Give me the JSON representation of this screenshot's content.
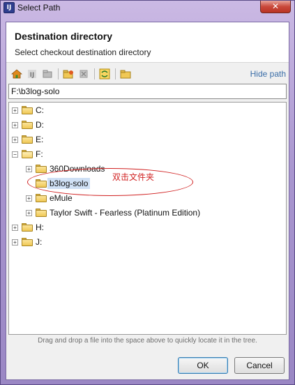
{
  "window": {
    "title": "Select Path",
    "app_icon_text": "IJ",
    "close_glyph": "✕"
  },
  "header": {
    "title": "Destination directory",
    "subtitle": "Select checkout destination directory"
  },
  "toolbar": {
    "icons": [
      "home-icon",
      "project-icon",
      "module-icon",
      "new-folder-icon",
      "delete-icon",
      "refresh-icon",
      "show-hidden-icon"
    ],
    "hide_path_label": "Hide path"
  },
  "path": {
    "value": "F:\\b3log-solo"
  },
  "tree": {
    "nodes": [
      {
        "label": "C:",
        "expanded": false,
        "level": 0
      },
      {
        "label": "D:",
        "expanded": false,
        "level": 0
      },
      {
        "label": "E:",
        "expanded": false,
        "level": 0
      },
      {
        "label": "F:",
        "expanded": true,
        "level": 0
      },
      {
        "label": "360Downloads",
        "expanded": false,
        "level": 1
      },
      {
        "label": "b3log-solo",
        "expanded": false,
        "level": 1,
        "selected": true,
        "leaf": true
      },
      {
        "label": "eMule",
        "expanded": false,
        "level": 1
      },
      {
        "label": "Taylor Swift - Fearless (Platinum Edition)",
        "expanded": false,
        "level": 1
      },
      {
        "label": "H:",
        "expanded": false,
        "level": 0
      },
      {
        "label": "J:",
        "expanded": false,
        "level": 0
      }
    ]
  },
  "annotation": {
    "text": "双击文件夹",
    "color": "#d02020"
  },
  "hint": "Drag and drop a file into the space above to quickly locate it in the tree.",
  "buttons": {
    "ok": "OK",
    "cancel": "Cancel"
  },
  "colors": {
    "accent_link": "#3b6ea8",
    "selection": "#cfe0f5"
  }
}
